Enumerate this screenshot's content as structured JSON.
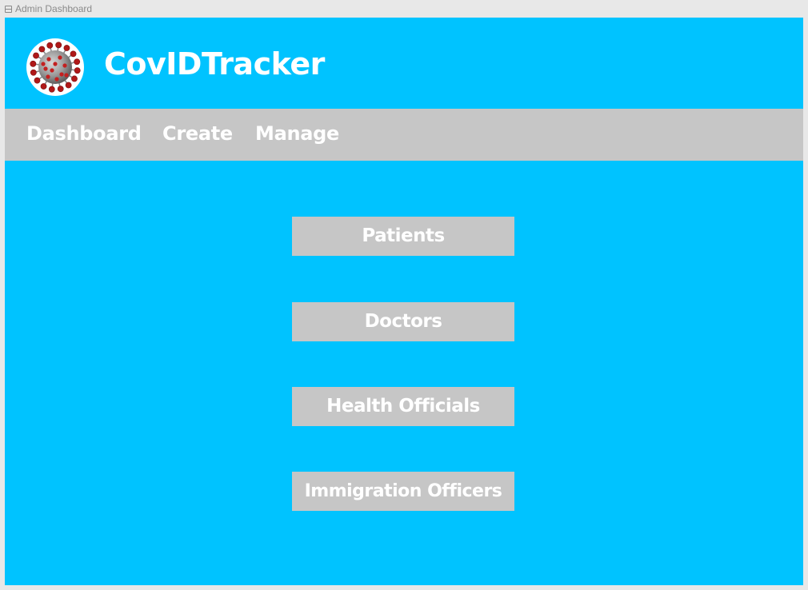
{
  "window": {
    "frame_label": "Admin Dashboard",
    "frame_icon": "frame-icon"
  },
  "header": {
    "app_title": "CovIDTracker",
    "logo_icon": "virus-icon"
  },
  "nav": {
    "items": [
      {
        "label": "Dashboard"
      },
      {
        "label": "Create"
      },
      {
        "label": "Manage"
      }
    ]
  },
  "main": {
    "buttons": [
      {
        "label": "Patients"
      },
      {
        "label": "Doctors"
      },
      {
        "label": "Health Officials"
      },
      {
        "label": "Immigration Officers"
      }
    ]
  },
  "colors": {
    "primary_background": "#00c3ff",
    "navbar_background": "#c6c6c6",
    "button_background": "#c6c6c6",
    "text": "#ffffff"
  }
}
